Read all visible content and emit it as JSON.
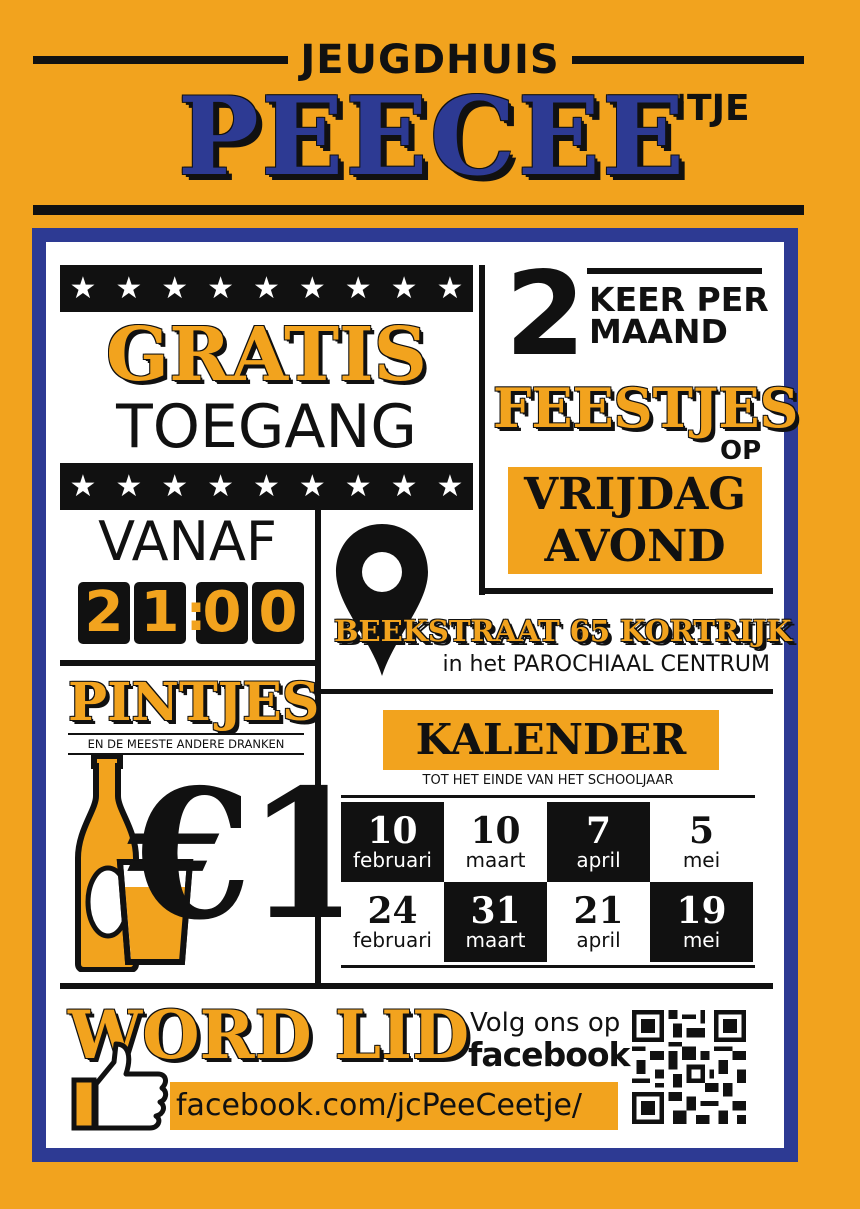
{
  "header": {
    "small_title": "JEUGDHUIS",
    "big_title": "PEECEE",
    "suffix": "'TJE"
  },
  "entry": {
    "title": "GRATIS",
    "subtitle": "TOEGANG",
    "stars": [
      "★",
      "★",
      "★",
      "★",
      "★",
      "★",
      "★",
      "★",
      "★"
    ]
  },
  "frequency": {
    "number": "2",
    "line1": "KEER PER",
    "line2": "MAAND",
    "parties": "FEESTJES",
    "on": "OP",
    "day1": "VRIJDAG",
    "day2": "AVOND"
  },
  "time": {
    "from": "VANAF",
    "digits": [
      "2",
      "1",
      "0",
      "0"
    ],
    "colon": ":"
  },
  "location": {
    "address": "BEEKSTRAAT 65 KORTRIJK",
    "detail": "in het PAROCHIAAL CENTRUM"
  },
  "drinks": {
    "title": "PINTJES",
    "subtitle": "EN DE MEESTE ANDERE DRANKEN",
    "price": "€1"
  },
  "calendar": {
    "title": "KALENDER",
    "subtitle": "TOT HET EINDE VAN HET SCHOOLJAAR",
    "dates": [
      {
        "day": "10",
        "month": "februari"
      },
      {
        "day": "10",
        "month": "maart"
      },
      {
        "day": "7",
        "month": "april"
      },
      {
        "day": "5",
        "month": "mei"
      },
      {
        "day": "24",
        "month": "februari"
      },
      {
        "day": "31",
        "month": "maart"
      },
      {
        "day": "21",
        "month": "april"
      },
      {
        "day": "19",
        "month": "mei"
      }
    ]
  },
  "membership": {
    "title": "WORD LID",
    "follow": "Volg ons op",
    "network": "facebook",
    "url": "facebook.com/jcPeeCeetje/"
  },
  "colors": {
    "orange": "#f2a31e",
    "navy": "#2d3a93",
    "black": "#111111",
    "white": "#ffffff"
  }
}
